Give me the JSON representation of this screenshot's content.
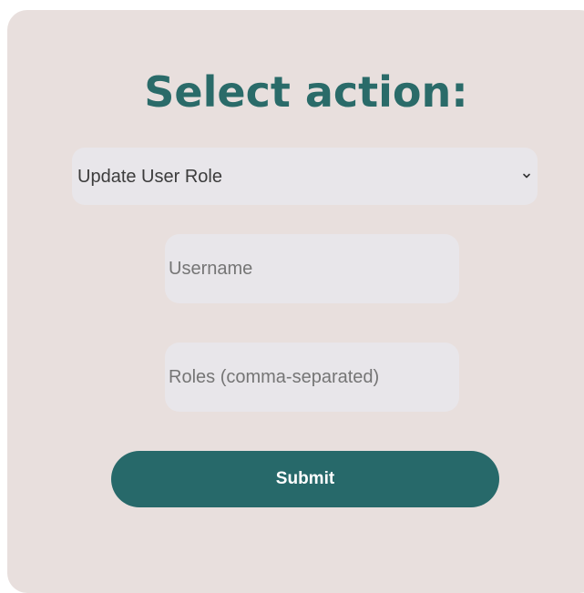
{
  "form": {
    "title": "Select action:",
    "action_select": {
      "selected": "Update User Role",
      "icon": "chevron-down-icon"
    },
    "username": {
      "value": "",
      "placeholder": "Username"
    },
    "roles": {
      "value": "",
      "placeholder": "Roles (comma-separated)"
    },
    "submit_label": "Submit"
  },
  "colors": {
    "panel_background": "#e8dfdd",
    "accent": "#27696a",
    "field_background": "#e8e6ea"
  }
}
